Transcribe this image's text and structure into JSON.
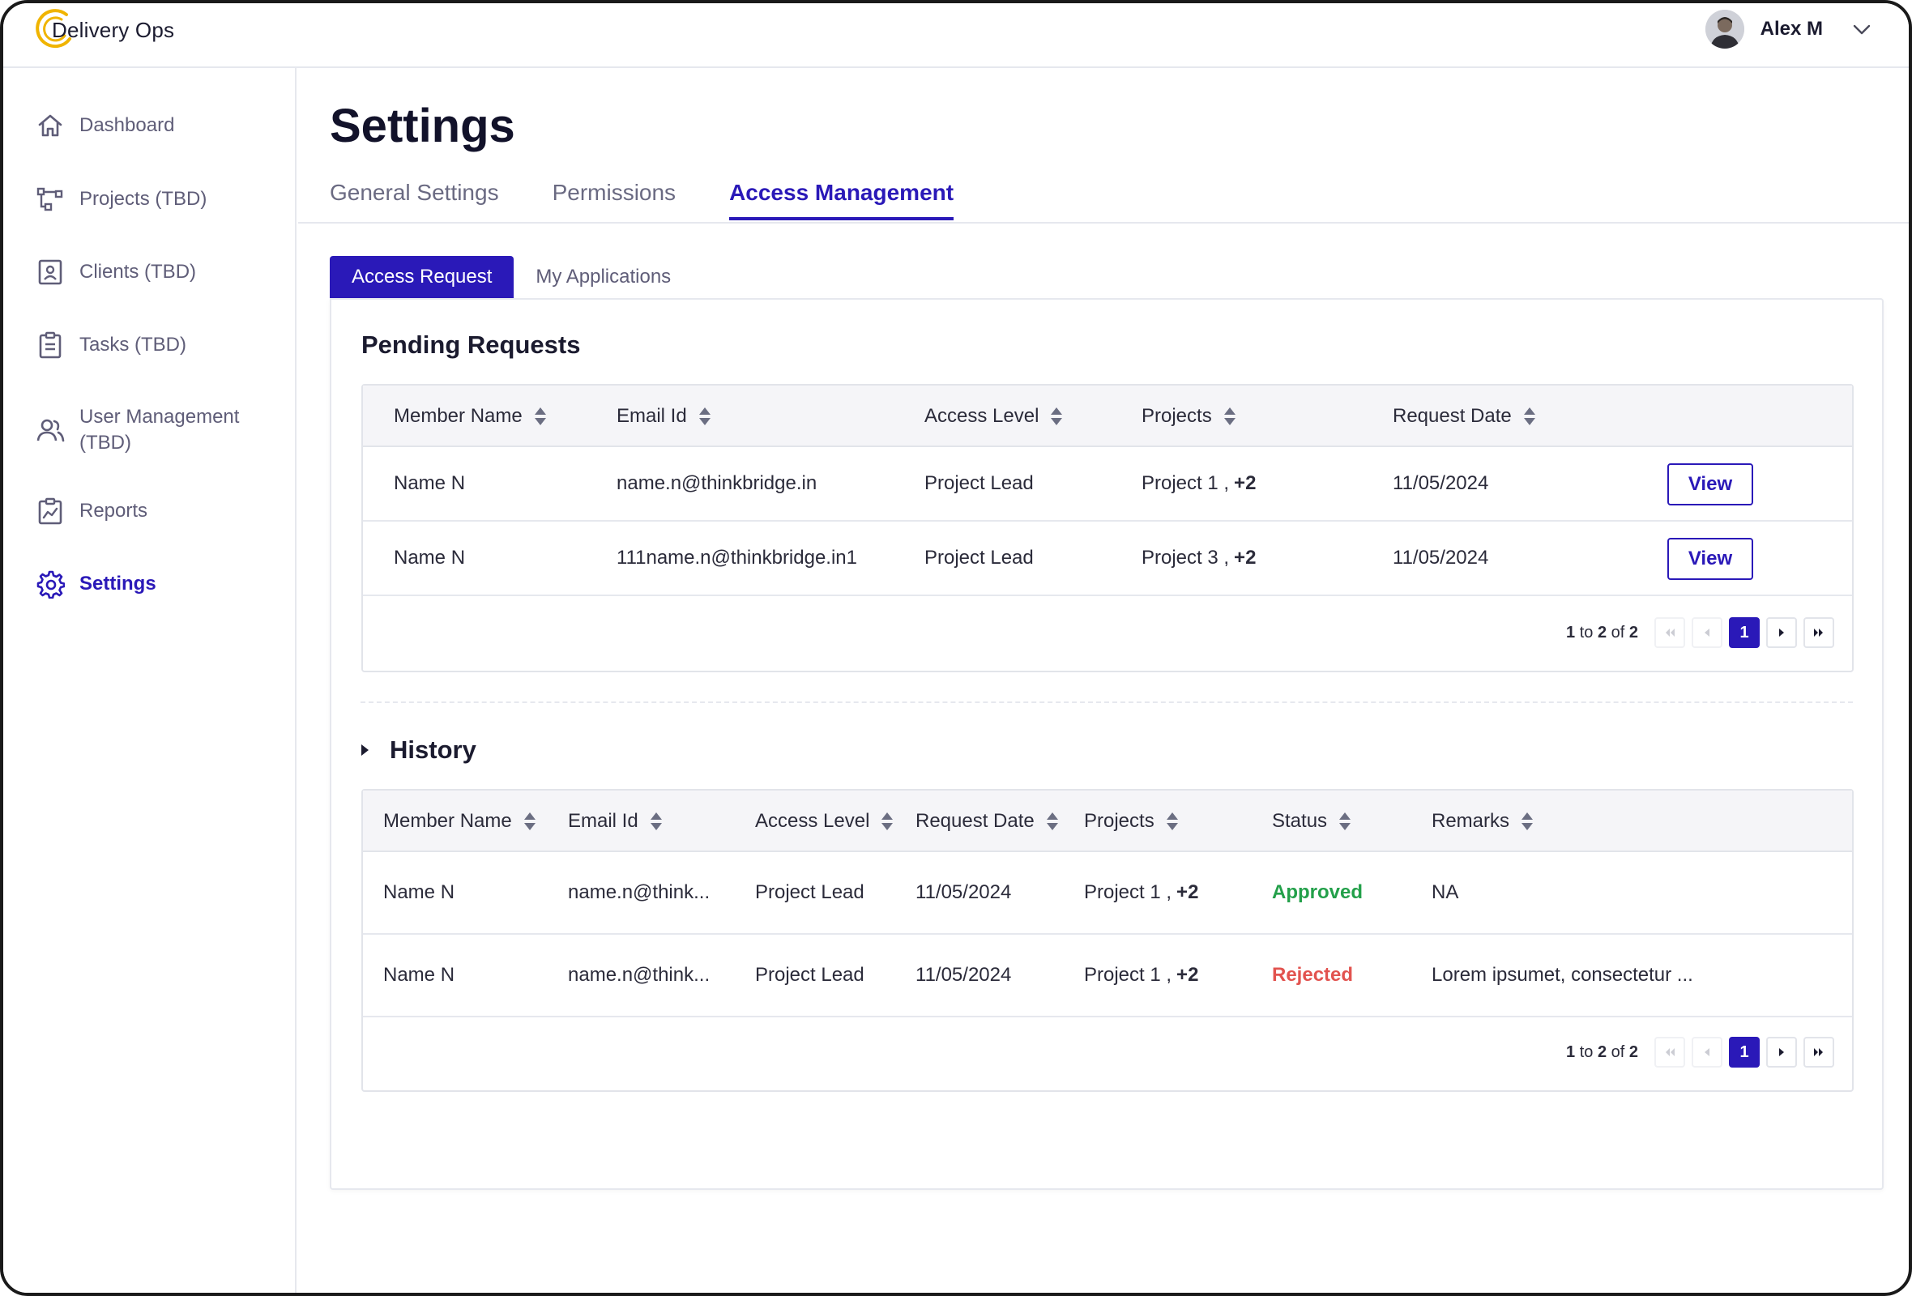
{
  "app": {
    "name": "Delivery Ops"
  },
  "user": {
    "name": "Alex M"
  },
  "sidebar": {
    "items": [
      {
        "label": "Dashboard",
        "icon": "home-icon"
      },
      {
        "label": "Projects (TBD)",
        "icon": "hierarchy-icon"
      },
      {
        "label": "Clients (TBD)",
        "icon": "contact-card-icon"
      },
      {
        "label": "Tasks (TBD)",
        "icon": "clipboard-icon"
      },
      {
        "label_line1": "User Management",
        "label_line2": "(TBD)",
        "icon": "users-icon"
      },
      {
        "label": "Reports",
        "icon": "report-chart-icon"
      },
      {
        "label": "Settings",
        "icon": "gear-icon",
        "active": true
      }
    ]
  },
  "page": {
    "title": "Settings",
    "tabs": [
      "General Settings",
      "Permissions",
      "Access Management"
    ],
    "active_tab": "Access Management",
    "subtabs": [
      "Access Request",
      "My Applications"
    ],
    "active_subtab": "Access Request"
  },
  "pending": {
    "title": "Pending Requests",
    "columns": [
      "Member Name",
      "Email Id",
      "Access Level",
      "Projects",
      "Request Date"
    ],
    "rows": [
      {
        "name": "Name N",
        "email": "name.n@thinkbridge.in",
        "access": "Project Lead",
        "project": "Project 1 ,",
        "extra": "+2",
        "date": "11/05/2024",
        "action": "View"
      },
      {
        "name": "Name N",
        "email": "111name.n@thinkbridge.in1",
        "access": "Project Lead",
        "project": "Project 3 ,",
        "extra": "+2",
        "date": "11/05/2024",
        "action": "View"
      }
    ],
    "pager": {
      "from": "1",
      "to_word": "to",
      "to": "2",
      "of_word": "of",
      "total": "2",
      "current": "1"
    }
  },
  "history": {
    "title": "History",
    "columns": [
      "Member Name",
      "Email Id",
      "Access Level",
      "Request Date",
      "Projects",
      "Status",
      "Remarks"
    ],
    "rows": [
      {
        "name": "Name N",
        "email": "name.n@think...",
        "access": "Project Lead",
        "date": "11/05/2024",
        "project": "Project 1 ,",
        "extra": "+2",
        "status": "Approved",
        "remarks": "NA"
      },
      {
        "name": "Name N",
        "email": "name.n@think...",
        "access": "Project Lead",
        "date": "11/05/2024",
        "project": "Project 1 ,",
        "extra": "+2",
        "status": "Rejected",
        "remarks": "Lorem ipsumet, consectetur ..."
      }
    ],
    "pager": {
      "from": "1",
      "to_word": "to",
      "to": "2",
      "of_word": "of",
      "total": "2",
      "current": "1"
    }
  },
  "colors": {
    "accent": "#2a19b8",
    "approved": "#23a04a",
    "rejected": "#e2534f",
    "logo": "#f0b400"
  }
}
